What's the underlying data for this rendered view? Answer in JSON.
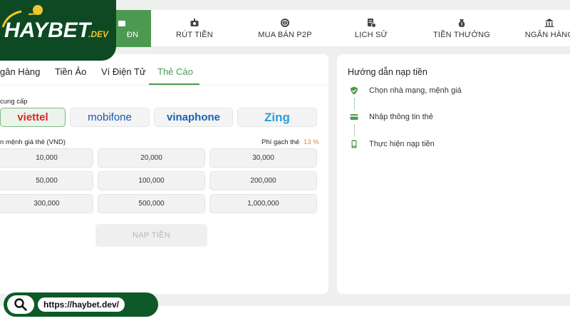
{
  "brand": {
    "logo_text": "HAYBET",
    "logo_suffix": ".DEV",
    "accent": "#4c9a52",
    "dark_green": "#0d4a23"
  },
  "nav": {
    "items": [
      {
        "label": "ĐN",
        "icon": "deposit-icon",
        "active": true
      },
      {
        "label": "RÚT TIỀN",
        "icon": "withdraw-icon"
      },
      {
        "label": "MUA BÁN P2P",
        "icon": "coin-icon"
      },
      {
        "label": "LỊCH SỬ",
        "icon": "history-icon"
      },
      {
        "label": "TIỀN THƯỞNG",
        "icon": "money-bag-icon"
      },
      {
        "label": "NGÂN HÀNG",
        "icon": "bank-icon"
      }
    ]
  },
  "tabs": [
    {
      "label": "gân Hàng"
    },
    {
      "label": "Tiền Ảo"
    },
    {
      "label": "Ví Điện Tử"
    },
    {
      "label": "Thẻ Cào",
      "active": true
    }
  ],
  "form": {
    "provider_label": "cung cấp",
    "providers": [
      {
        "label": "viettel",
        "color": "#e0242b",
        "selected": true
      },
      {
        "label": "mobifone",
        "color": "#1c56b3"
      },
      {
        "label": "vinaphone",
        "color": "#1a63b8"
      },
      {
        "label": "Zing",
        "color": "#2f9be0"
      }
    ],
    "amount_label": "n mệnh giá thẻ (VND)",
    "fee_label": "Phí gạch thẻ",
    "fee_value": "13 %",
    "fee_color": "#e8833a",
    "amounts": [
      "10,000",
      "20,000",
      "30,000",
      "50,000",
      "100,000",
      "200,000",
      "300,000",
      "500,000",
      "1,000,000"
    ],
    "submit_label": "NẠP TIỀN"
  },
  "guide": {
    "title": "Hướng dẫn nạp tiền",
    "steps": [
      {
        "label": "Chọn nhà mạng, mệnh giá",
        "icon": "shield-check-icon"
      },
      {
        "label": "Nhập thông tin thẻ",
        "icon": "card-icon"
      },
      {
        "label": "Thực hiện nạp tiền",
        "icon": "phone-icon"
      }
    ]
  },
  "url": {
    "text": "https://haybet.dev/",
    "icon": "search-icon"
  }
}
